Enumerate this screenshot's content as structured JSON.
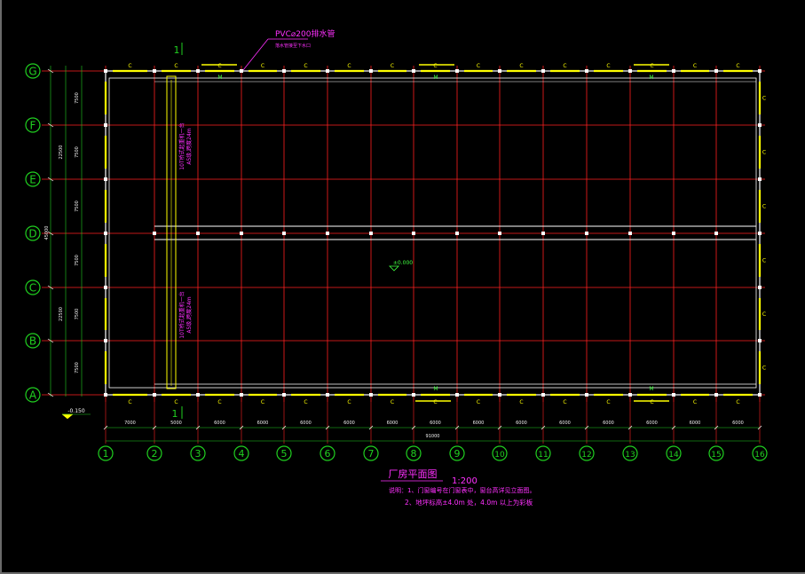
{
  "drawing": {
    "title": "厂房平面图",
    "scale": "1:200",
    "notes": [
      "说明：1、门窗编号在门窗表中，窗台高详见立面图。",
      "2、地坪标高±4.0m 处，4.0m 以上为彩板"
    ],
    "pipe_label": "PVC⌀200排水管",
    "pipe_sub": "落水管接至下水口",
    "elev_main": "±0.000",
    "elev_out": "-0.150",
    "section_mark": "1",
    "crane_label_1": "10T桥式起重机一台",
    "crane_label_2": "A5级,跨度24m",
    "door_mark": "M",
    "window_mark": "C"
  },
  "grid": {
    "rows": [
      "G",
      "F",
      "E",
      "D",
      "C",
      "B",
      "A"
    ],
    "cols": [
      "1",
      "2",
      "3",
      "4",
      "5",
      "6",
      "7",
      "8",
      "9",
      "10",
      "11",
      "12",
      "13",
      "14",
      "15",
      "16"
    ],
    "row_spacing": [
      "7500",
      "7500",
      "7500",
      "7500",
      "7500",
      "7500"
    ],
    "col_spacing": [
      "7000",
      "5000",
      "6000",
      "6000",
      "6000",
      "6000",
      "6000",
      "6000",
      "6000",
      "6000",
      "6000",
      "6000",
      "6000",
      "6000",
      "6000"
    ],
    "total_length": "91000",
    "total_width": "45000",
    "half_width_1": "22500",
    "half_width_2": "22500"
  },
  "colors": {
    "grid_line": "#ff2020",
    "bubble": "#20d020",
    "wall": "#ffffff",
    "window": "#ffff00",
    "magenta": "#ff30ff",
    "dim": "#f0f0f0"
  }
}
